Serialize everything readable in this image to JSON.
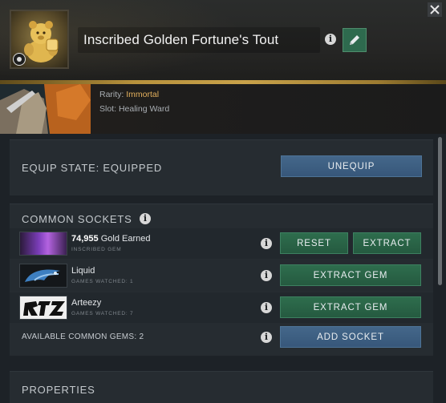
{
  "item": {
    "title": "Inscribed Golden Fortune's Tout",
    "rarity_label": "Rarity:",
    "rarity_value": "Immortal",
    "slot_label": "Slot:",
    "slot_value": "Healing Ward"
  },
  "equip": {
    "state_label": "EQUIP STATE: EQUIPPED",
    "unequip_label": "UNEQUIP"
  },
  "sockets": {
    "title": "COMMON SOCKETS",
    "rows": [
      {
        "value": "74,955",
        "stat": "Gold Earned",
        "subtitle": "INSCRIBED GEM",
        "buttons": [
          "RESET",
          "EXTRACT"
        ]
      },
      {
        "value": "",
        "stat": "Liquid",
        "subtitle": "GAMES WATCHED: 1",
        "buttons": [
          "EXTRACT GEM"
        ]
      },
      {
        "value": "",
        "stat": "Arteezy",
        "subtitle": "GAMES WATCHED: 7",
        "buttons": [
          "EXTRACT GEM"
        ]
      }
    ],
    "available_label": "AVAILABLE COMMON GEMS: 2",
    "add_socket_label": "ADD SOCKET"
  },
  "properties": {
    "title": "PROPERTIES"
  },
  "colors": {
    "rarity_immortal": "#e3b05d",
    "button_green": "#2e6d4d",
    "button_blue": "#3e6083",
    "gold_bar": "#c9a24a"
  },
  "icons": {
    "info": "info-icon",
    "edit": "pencil-icon",
    "close": "close-icon"
  }
}
